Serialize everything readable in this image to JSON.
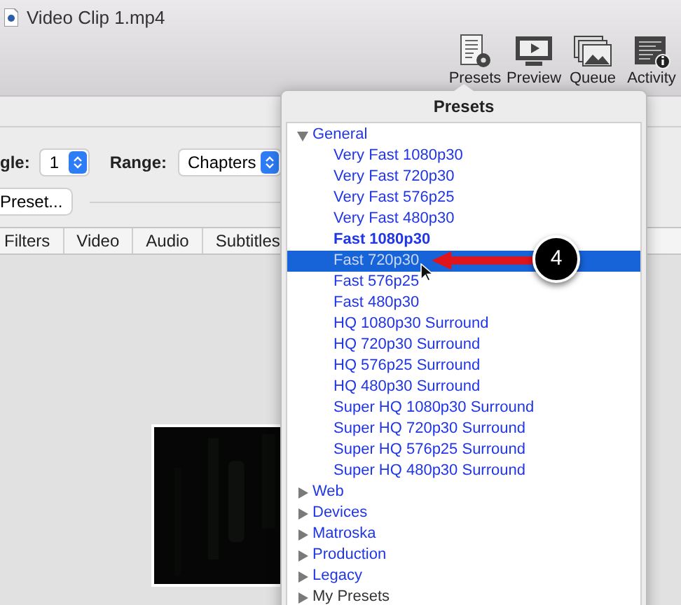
{
  "window": {
    "title": "Video Clip 1.mp4"
  },
  "toolbar": [
    {
      "label": "Presets",
      "kind": "presets"
    },
    {
      "label": "Preview",
      "kind": "preview"
    },
    {
      "label": "Queue",
      "kind": "queue"
    },
    {
      "label": "Activity",
      "kind": "activity"
    }
  ],
  "source": {
    "angle_label": "gle:",
    "angle_value": "1",
    "range_label": "Range:",
    "range_value": "Chapters",
    "preset_button": "Preset..."
  },
  "tabs": [
    {
      "label": "Filters",
      "selected": false
    },
    {
      "label": "Video",
      "selected": false
    },
    {
      "label": "Audio",
      "selected": false
    },
    {
      "label": "Subtitles",
      "selected": false
    }
  ],
  "presets_popover": {
    "title": "Presets",
    "tree": [
      {
        "label": "General",
        "expanded": true,
        "children": [
          {
            "label": "Very Fast 1080p30",
            "selected": false,
            "default": false
          },
          {
            "label": "Very Fast 720p30",
            "selected": false,
            "default": false
          },
          {
            "label": "Very Fast 576p25",
            "selected": false,
            "default": false
          },
          {
            "label": "Very Fast 480p30",
            "selected": false,
            "default": false
          },
          {
            "label": "Fast 1080p30",
            "selected": false,
            "default": true
          },
          {
            "label": "Fast 720p30",
            "selected": true,
            "default": false
          },
          {
            "label": "Fast 576p25",
            "selected": false,
            "default": false
          },
          {
            "label": "Fast 480p30",
            "selected": false,
            "default": false
          },
          {
            "label": "HQ 1080p30 Surround",
            "selected": false,
            "default": false
          },
          {
            "label": "HQ 720p30 Surround",
            "selected": false,
            "default": false
          },
          {
            "label": "HQ 576p25 Surround",
            "selected": false,
            "default": false
          },
          {
            "label": "HQ 480p30 Surround",
            "selected": false,
            "default": false
          },
          {
            "label": "Super HQ 1080p30 Surround",
            "selected": false,
            "default": false
          },
          {
            "label": "Super HQ 720p30 Surround",
            "selected": false,
            "default": false
          },
          {
            "label": "Super HQ 576p25 Surround",
            "selected": false,
            "default": false
          },
          {
            "label": "Super HQ 480p30 Surround",
            "selected": false,
            "default": false
          }
        ]
      },
      {
        "label": "Web",
        "expanded": false,
        "custom": false
      },
      {
        "label": "Devices",
        "expanded": false,
        "custom": false
      },
      {
        "label": "Matroska",
        "expanded": false,
        "custom": false
      },
      {
        "label": "Production",
        "expanded": false,
        "custom": false
      },
      {
        "label": "Legacy",
        "expanded": false,
        "custom": false
      },
      {
        "label": "My Presets",
        "expanded": false,
        "custom": true
      }
    ]
  },
  "callout": {
    "number": "4"
  }
}
